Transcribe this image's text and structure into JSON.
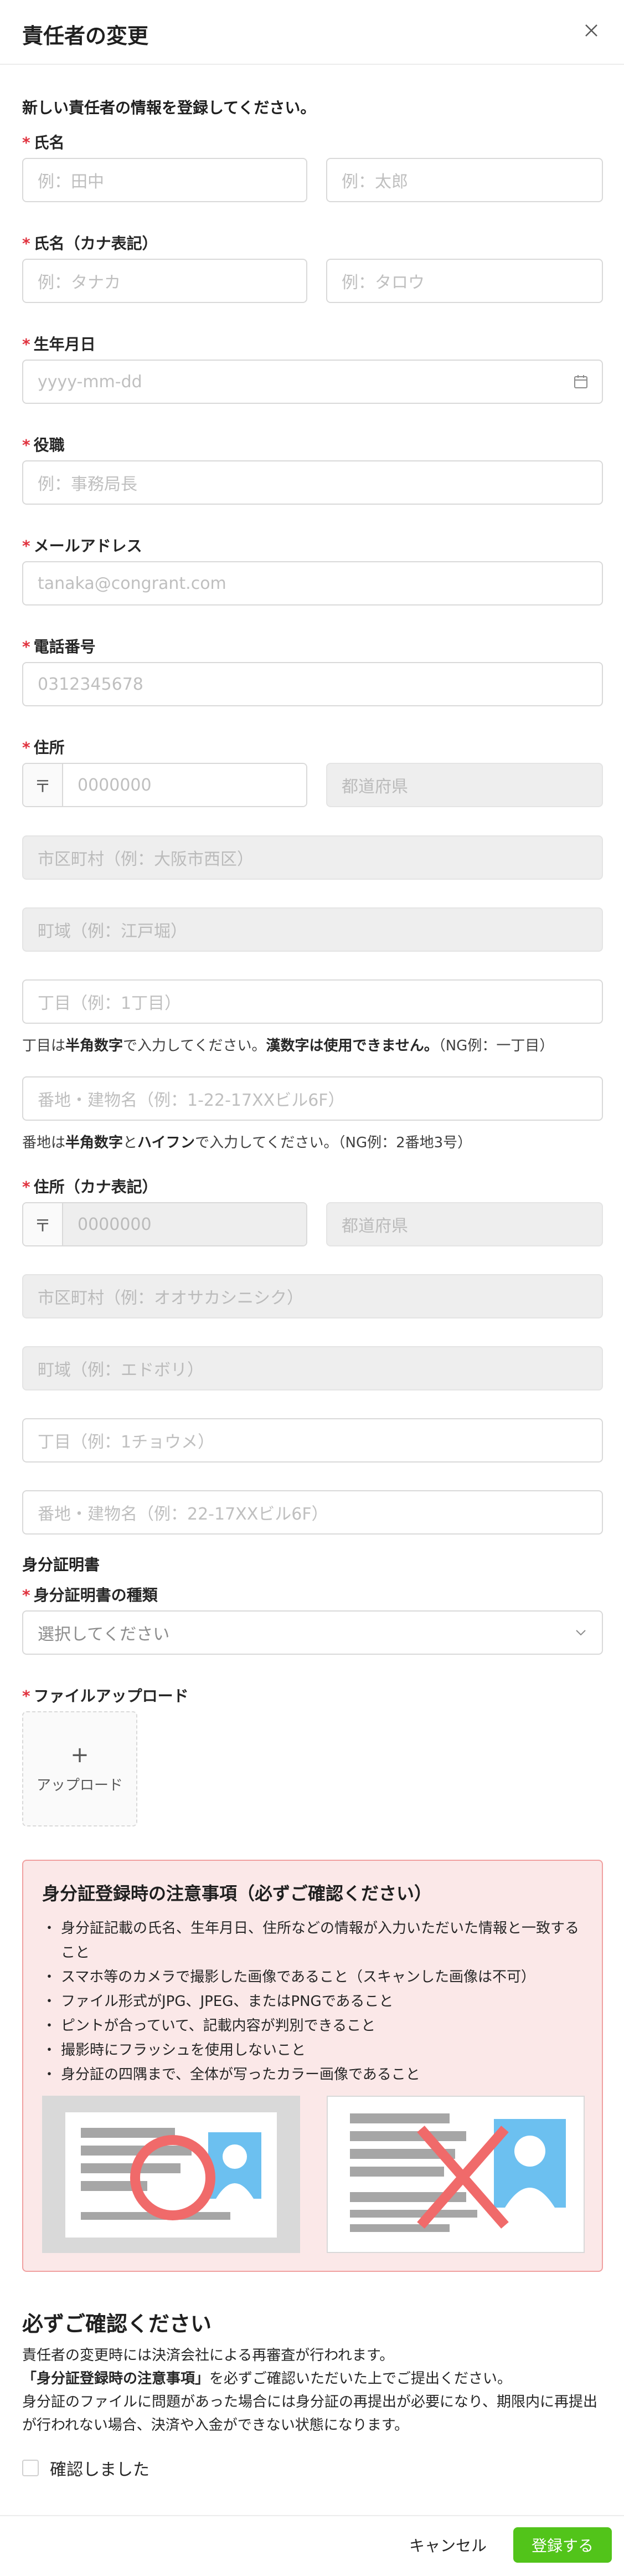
{
  "modal": {
    "title": "責任者の変更"
  },
  "intro": "新しい責任者の情報を登録してください。",
  "required_mark": "*",
  "fields": {
    "name": {
      "label": "氏名",
      "last_placeholder": "例：田中",
      "first_placeholder": "例：太郎"
    },
    "name_kana": {
      "label": "氏名（カナ表記）",
      "last_placeholder": "例：タナカ",
      "first_placeholder": "例：タロウ"
    },
    "birthdate": {
      "label": "生年月日",
      "placeholder": "yyyy-mm-dd"
    },
    "position": {
      "label": "役職",
      "placeholder": "例：事務局長"
    },
    "email": {
      "label": "メールアドレス",
      "placeholder": "tanaka@congrant.com"
    },
    "phone": {
      "label": "電話番号",
      "placeholder": "0312345678"
    },
    "address": {
      "label": "住所",
      "zip_prefix": "〒",
      "zip_placeholder": "0000000",
      "prefecture_placeholder": "都道府県",
      "city_placeholder": "市区町村（例：大阪市西区）",
      "town_placeholder": "町域（例：江戸堀）",
      "chome_placeholder": "丁目（例：1丁目）",
      "chome_help": {
        "t1": "丁目は",
        "b1": "半角数字",
        "t2": "で入力してください。",
        "b2": "漢数字は使用できません。",
        "t3": "（NG例：一丁目）"
      },
      "building_placeholder": "番地・建物名（例：1-22-17XXビル6F）",
      "building_help": {
        "t1": "番地は",
        "b1": "半角数字",
        "t2": "と",
        "b2": "ハイフン",
        "t3": "で入力してください。（NG例：2番地3号）"
      }
    },
    "address_kana": {
      "label": "住所（カナ表記）",
      "zip_prefix": "〒",
      "zip_placeholder": "0000000",
      "prefecture_placeholder": "都道府県",
      "city_placeholder": "市区町村（例：オオサカシニシク）",
      "town_placeholder": "町域（例：エドボリ）",
      "chome_placeholder": "丁目（例：1チョウメ）",
      "building_placeholder": "番地・建物名（例：22-17XXビル6F）"
    }
  },
  "id_section": {
    "title": "身分証明書",
    "type_label": "身分証明書の種類",
    "type_placeholder": "選択してください",
    "upload_label": "ファイルアップロード",
    "upload_plus": "+",
    "upload_text": "アップロード"
  },
  "notice": {
    "title": "身分証登録時の注意事項（必ずご確認ください）",
    "items": [
      "身分証記載の氏名、生年月日、住所などの情報が入力いただいた情報と一致すること",
      "スマホ等のカメラで撮影した画像であること（スキャンした画像は不可）",
      "ファイル形式がJPG、JPEG、またはPNGであること",
      "ピントが合っていて、記載内容が判別できること",
      "撮影時にフラッシュを使用しないこと",
      "身分証の四隅まで、全体が写ったカラー画像であること"
    ]
  },
  "confirm": {
    "title": "必ずご確認ください",
    "line1": "責任者の変更時には決済会社による再審査が行われます。",
    "line2_bold": "「身分証登録時の注意事項」",
    "line2_rest": "を必ずご確認いただいた上でご提出ください。",
    "line3": "身分証のファイルに問題があった場合には身分証の再提出が必要になり、期限内に再提出が行われない場合、決済や入金ができない状態になります。",
    "checkbox_label": "確認しました"
  },
  "footer": {
    "cancel": "キャンセル",
    "submit": "登録する"
  },
  "colors": {
    "required": "#e0323e",
    "primary": "#52c41a",
    "notice_bg": "#fbe8e8",
    "notice_border": "#f0a0a0",
    "example_blue": "#6cc0f0",
    "example_mark": "#f06a6a"
  },
  "icons": {
    "close": "close-icon",
    "calendar": "calendar-icon",
    "chevron": "chevron-down-icon"
  }
}
